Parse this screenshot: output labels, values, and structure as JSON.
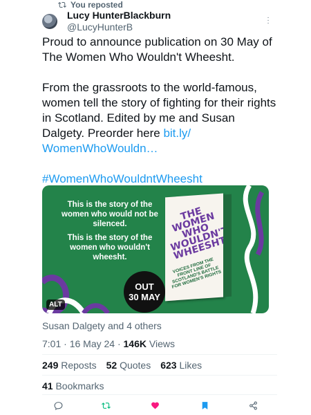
{
  "repost": {
    "label": "You reposted",
    "icon": "repost-icon"
  },
  "author": {
    "name": "Lucy HunterBlackburn",
    "handle": "@LucyHunterB",
    "avatar": "avatar"
  },
  "tweet": {
    "line1": "Proud to announce publication on 30 May of The Women Who Wouldn't Wheesht.",
    "line2_prefix": "From the grassroots to the world-famous, women tell the story of fighting for their rights in Scotland. Edited by me and Susan Dalgety. Preorder here ",
    "link": "bit.ly/\nWomenWhoWouldn…",
    "hashtag": "#WomenWhoWouldntWheesht"
  },
  "media": {
    "text1": "This is the story of the women who would not be silenced.",
    "text2": "This is the story of the women who wouldn't wheesht.",
    "badge_line1": "OUT",
    "badge_line2": "30 MAY",
    "alt_label": "ALT",
    "book_title": "THE WOMEN WHO WOULDN'T WHEESHT",
    "book_subtitle": "VOICES FROM THE FRONT LINE OF SCOTLAND'S BATTLE FOR WOMEN'S RIGHTS",
    "colors": {
      "background": "#23834a",
      "purple": "#6b3aa0",
      "white": "#ffffff"
    }
  },
  "social_context": "Susan Dalgety and 4 others",
  "meta": {
    "time_date": "7:01 · 16 May 24 · ",
    "views_count": "146K",
    "views_label": " Views"
  },
  "stats": {
    "reposts_count": "249",
    "reposts_label": "Reposts",
    "quotes_count": "52",
    "quotes_label": "Quotes",
    "likes_count": "623",
    "likes_label": "Likes",
    "bookmarks_count": "41",
    "bookmarks_label": "Bookmarks"
  },
  "actions": [
    {
      "name": "reply-icon",
      "color": "#536471"
    },
    {
      "name": "repost-icon",
      "color": "#00ba7c"
    },
    {
      "name": "like-icon",
      "color": "#f91880"
    },
    {
      "name": "bookmark-icon",
      "color": "#1d9bf0"
    },
    {
      "name": "share-icon",
      "color": "#536471"
    }
  ]
}
